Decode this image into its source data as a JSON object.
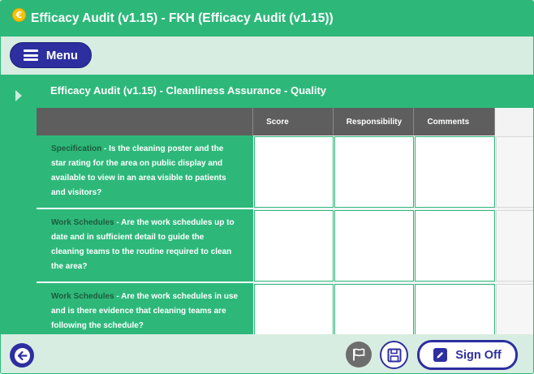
{
  "window": {
    "logo_glyph": "€",
    "title": "Efficacy Audit (v1.15) - FKH (Efficacy Audit (v1.15))"
  },
  "menu": {
    "label": "Menu",
    "icon": "hamburger-icon"
  },
  "section": {
    "title": "Efficacy Audit (v1.15) - Cleanliness Assurance - Quality",
    "toggle_icon": "chevron-right-icon"
  },
  "table": {
    "columns": [
      "",
      "Score",
      "Responsibility",
      "Comments",
      ""
    ],
    "rows": [
      {
        "label": "Specification",
        "text": " - Is the cleaning poster and the star rating for the area on public display and available to view in an area visible to patients and visitors?",
        "score": "",
        "responsibility": "",
        "comments": ""
      },
      {
        "label": "Work Schedules",
        "text": " - Are the work schedules up to date and in sufficient detail to guide the cleaning teams to the routine required to clean the area?",
        "score": "",
        "responsibility": "",
        "comments": ""
      },
      {
        "label": "Work Schedules",
        "text": " - Are the work schedules in use and is there evidence that cleaning teams are following the schedule?",
        "score": "",
        "responsibility": "",
        "comments": ""
      }
    ]
  },
  "footer": {
    "back_icon": "back-arrow-icon",
    "flag_icon": "flag-icon",
    "save_icon": "save-icon",
    "signoff_label": "Sign Off",
    "signoff_icon": "edit-icon"
  },
  "colors": {
    "brand_green": "#2db87a",
    "accent_blue": "#2d2fa0",
    "header_gray": "#5e5e5e",
    "background": "#d8ede1"
  }
}
